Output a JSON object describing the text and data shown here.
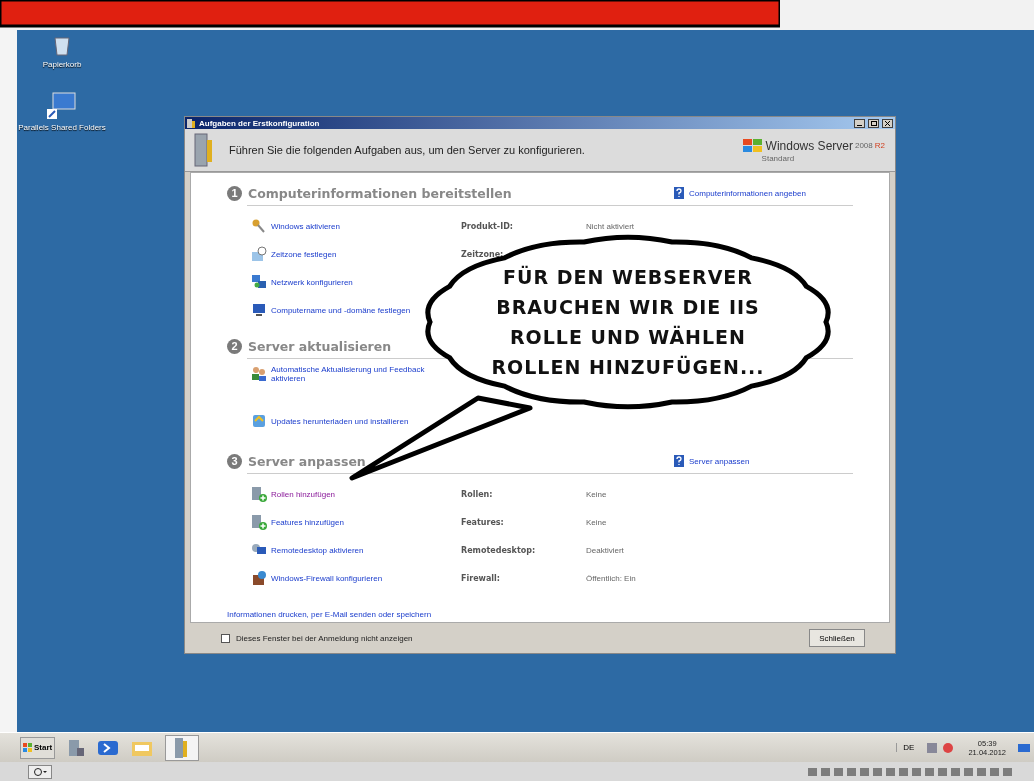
{
  "desktop_icons": [
    {
      "kind": "recycle",
      "label": "Papierkorb"
    },
    {
      "kind": "share",
      "label": "Parallels Shared Folders"
    }
  ],
  "window": {
    "title": "Aufgaben der Erstkonfiguration",
    "intro": "Führen Sie die folgenden Aufgaben aus, um den Server zu konfigurieren.",
    "brand": {
      "name": "Windows Server",
      "version": "2008",
      "release": "R2",
      "edition": "Standard"
    }
  },
  "sections": [
    {
      "number": "1",
      "title": "Computerinformationen bereitstellen",
      "help_link": "Computerinformationen angeben",
      "tasks": [
        {
          "kind": "key",
          "link": "Windows aktivieren",
          "visited": false,
          "label": "Produkt-ID:",
          "value": "Nicht aktiviert"
        },
        {
          "kind": "clock",
          "link": "Zeitzone festlegen",
          "visited": false,
          "label": "Zeitzone:"
        },
        {
          "kind": "network",
          "link": "Netzwerk konfigurieren",
          "visited": false
        },
        {
          "kind": "computer",
          "link": "Computername und -domäne festlegen",
          "visited": false
        }
      ]
    },
    {
      "number": "2",
      "title": "Server aktualisieren",
      "tasks": [
        {
          "kind": "users",
          "link": "Automatische Aktualisierung und Feedback aktivieren",
          "visited": false
        },
        {
          "kind": "update",
          "link": "Updates herunterladen und installieren",
          "visited": false
        }
      ]
    },
    {
      "number": "3",
      "title": "Server anpassen",
      "help_link": "Server anpassen",
      "tasks": [
        {
          "kind": "server-add",
          "link": "Rollen hinzufügen",
          "visited": true,
          "label": "Rollen:",
          "value": "Keine"
        },
        {
          "kind": "server-add",
          "link": "Features hinzufügen",
          "visited": false,
          "label": "Features:",
          "value": "Keine"
        },
        {
          "kind": "remote",
          "link": "Remotedesktop aktivieren",
          "visited": false,
          "label": "Remotedesktop:",
          "value": "Deaktiviert"
        },
        {
          "kind": "firewall",
          "link": "Windows-Firewall konfigurieren",
          "visited": false,
          "label": "Firewall:",
          "value": "Öffentlich: Ein"
        }
      ]
    }
  ],
  "footer_link": "Informationen drucken, per E-Mail senden oder speichern",
  "checkbox": {
    "label": "Dieses Fenster bei der Anmeldung nicht anzeigen",
    "checked": false
  },
  "close_button": "Schließen",
  "taskbar": {
    "start": "Start",
    "language": "DE",
    "time": "05:39",
    "date": "21.04.2012"
  },
  "speech_bubble": [
    "FÜR DEN WEBSERVER",
    "BRAUCHEN WIR DIE IIS",
    "ROLLE UND WÄHLEN",
    "ROLLEN HINZUFÜGEN..."
  ]
}
